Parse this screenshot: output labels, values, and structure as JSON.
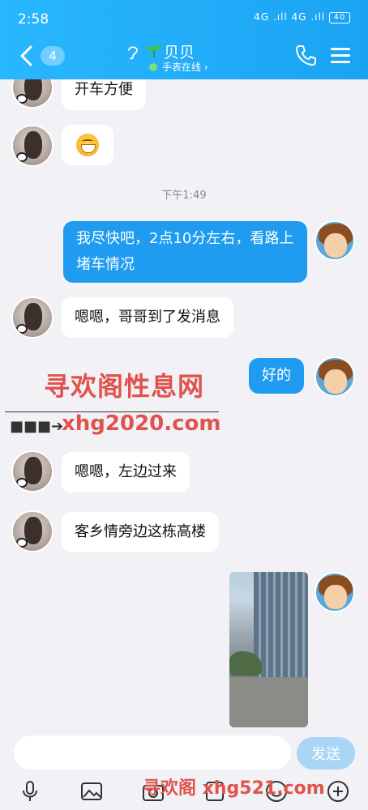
{
  "status_bar": {
    "time": "2:58",
    "network_icons": "4G .ıll 4G .ıll",
    "battery": "40"
  },
  "nav": {
    "unread_count": "4",
    "contact_name": "贝贝",
    "status": "手表在线 ›"
  },
  "messages": [
    {
      "side": "left",
      "text": "开车方便"
    },
    {
      "side": "left",
      "emoji": "grinning-face"
    },
    {
      "timestamp": "下午1:49"
    },
    {
      "side": "right",
      "text": "我尽快吧，2点10分左右，看路上堵车情况"
    },
    {
      "side": "left",
      "text": "嗯嗯，哥哥到了发消息"
    },
    {
      "side": "right",
      "text": "好的"
    },
    {
      "side": "left",
      "text": "嗯嗯，左边过来"
    },
    {
      "side": "left",
      "text": "客乡情旁边这栋高楼"
    },
    {
      "side": "right",
      "image": "building-photo"
    }
  ],
  "watermark": {
    "title": "寻欢阁性息网",
    "url": "xhg2020.com",
    "footer": "寻欢阁 xhg521.com"
  },
  "input": {
    "placeholder": "",
    "send_label": "发送"
  },
  "toolbar": [
    "mic-icon",
    "image-icon",
    "camera-icon",
    "file-icon",
    "emoji-icon",
    "add-icon"
  ]
}
